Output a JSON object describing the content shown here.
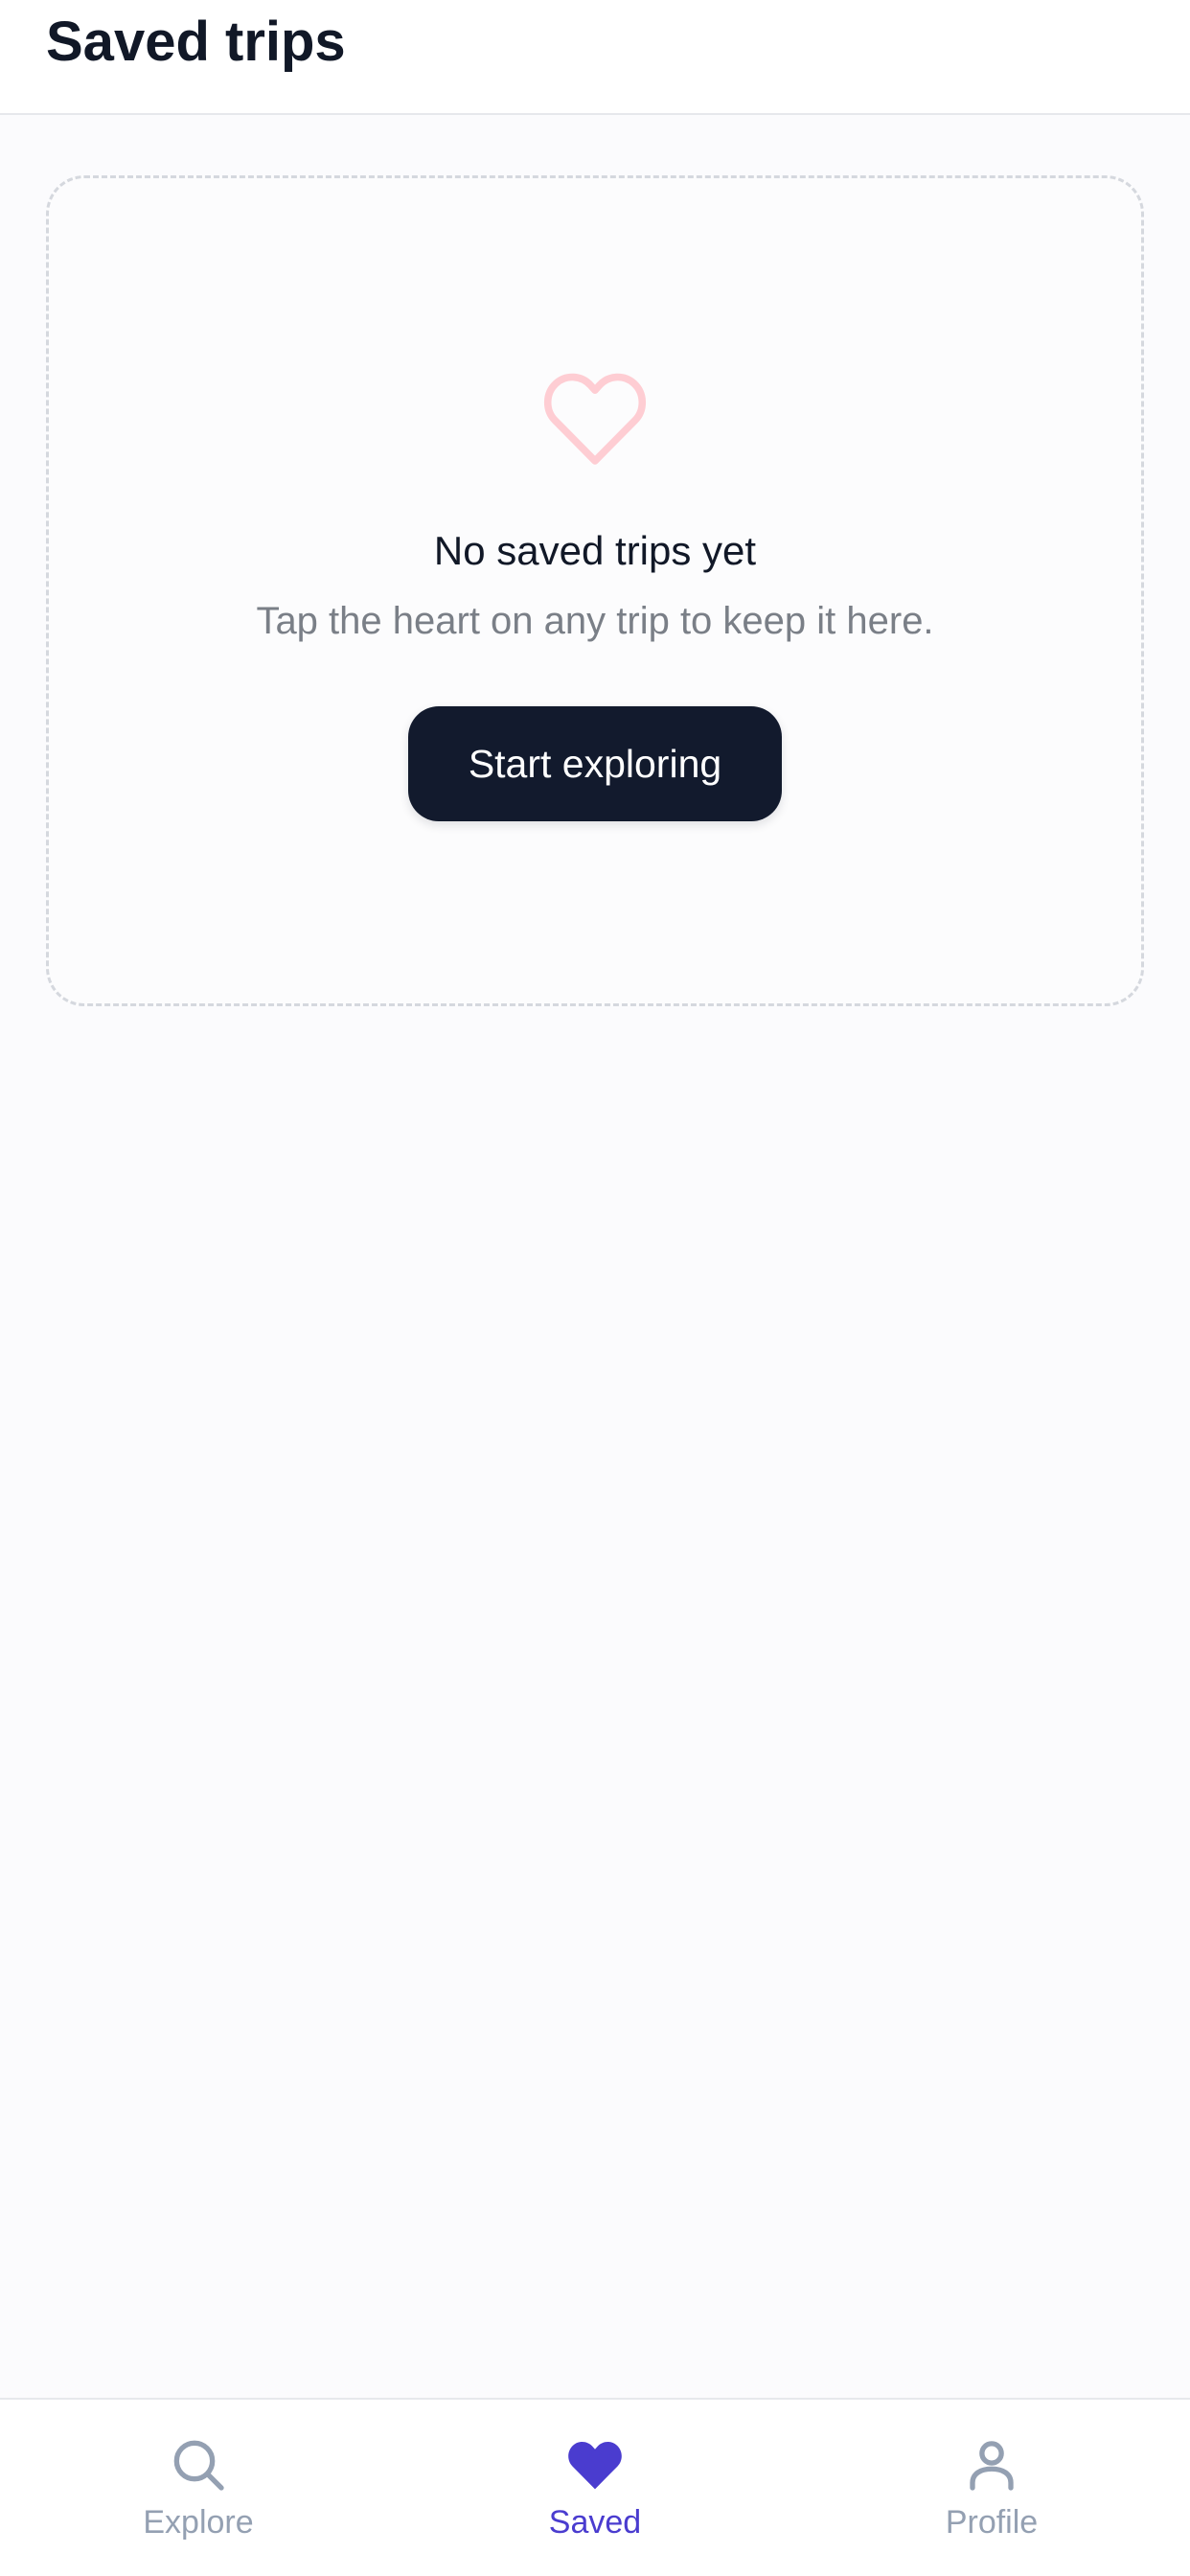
{
  "header": {
    "title": "Saved trips"
  },
  "empty_state": {
    "icon": "heart-outline-icon",
    "title": "No saved trips yet",
    "subtitle": "Tap the heart on any trip to keep it here.",
    "cta_label": "Start exploring"
  },
  "tab_bar": {
    "tabs": [
      {
        "label": "Explore",
        "icon": "search-icon",
        "active": false
      },
      {
        "label": "Saved",
        "icon": "heart-icon",
        "active": true
      },
      {
        "label": "Profile",
        "icon": "user-icon",
        "active": false
      }
    ]
  },
  "colors": {
    "accent": "#4a3ccf",
    "heart_outline": "#fecdd3",
    "button_bg": "#121a2d",
    "title_text": "#111827",
    "muted_text": "#7a7f87",
    "inactive_tab": "#94a0b2"
  }
}
